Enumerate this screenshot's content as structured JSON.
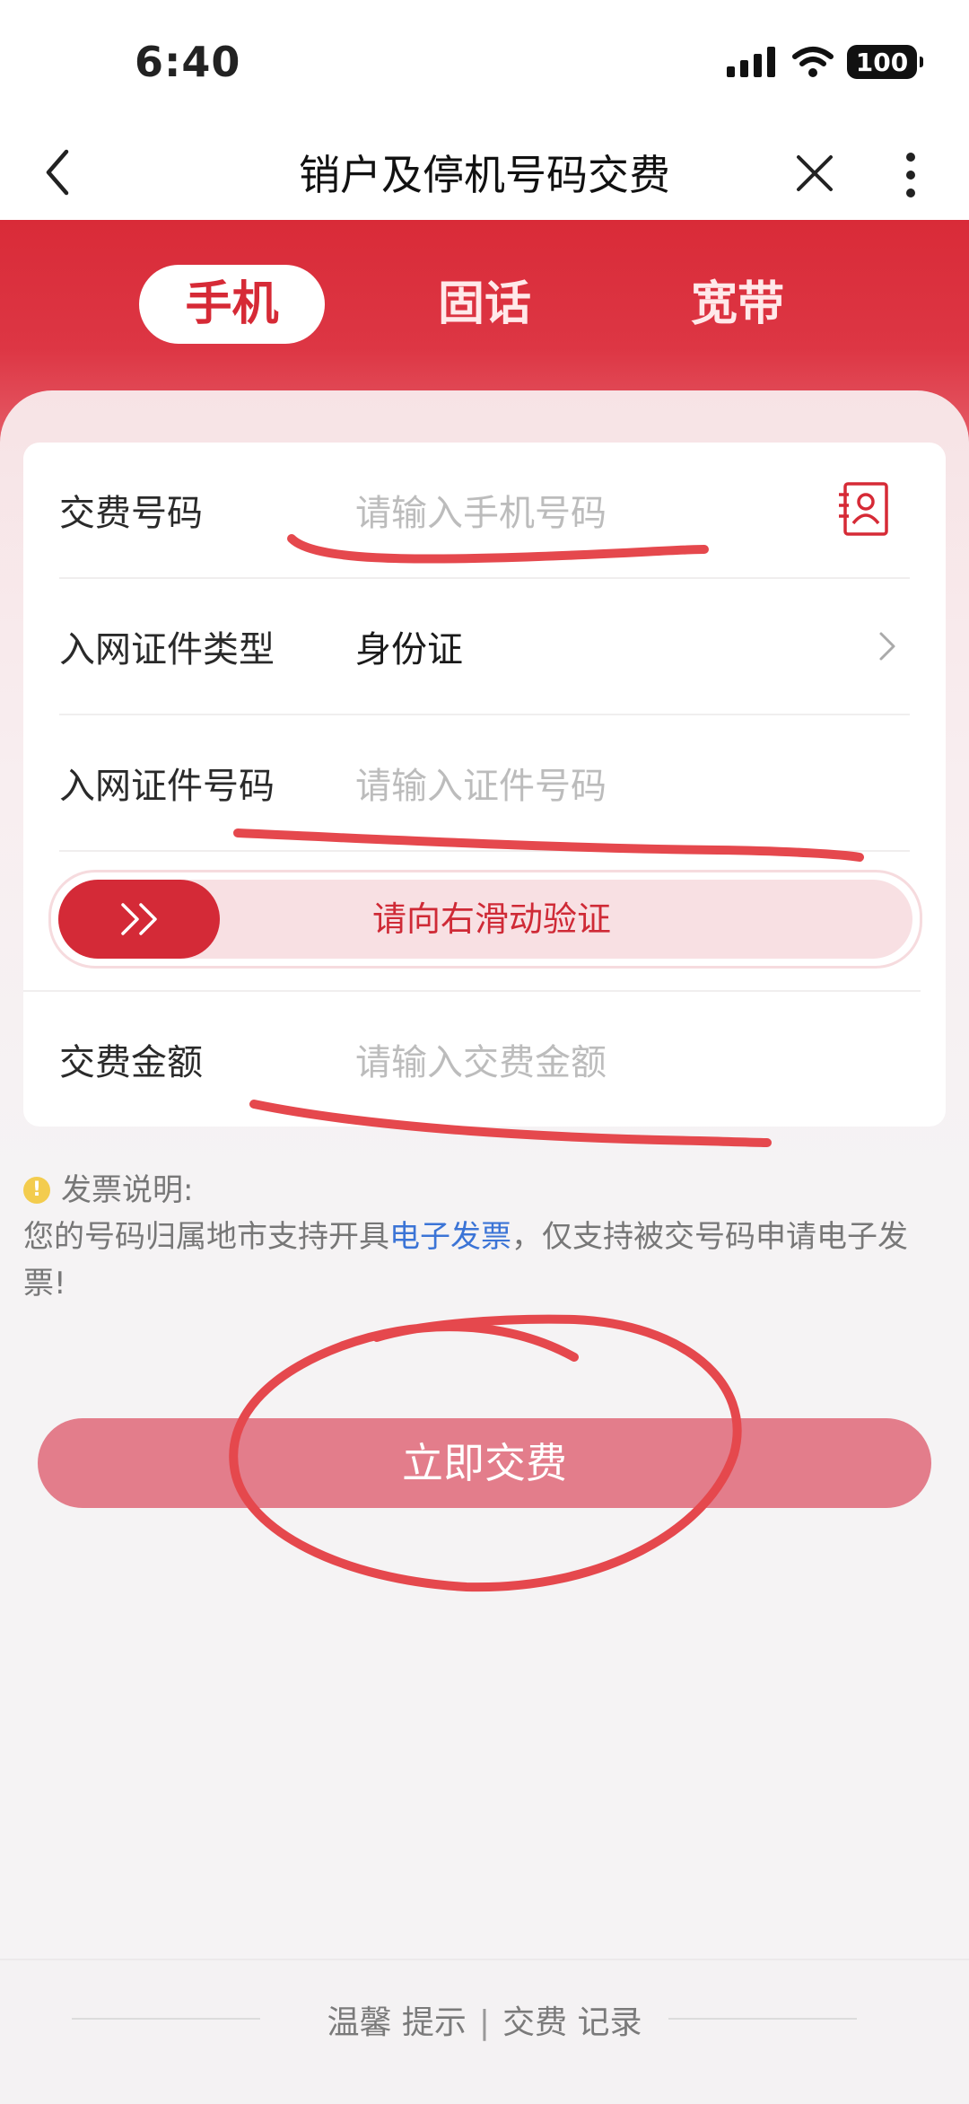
{
  "status_bar": {
    "time": "6:40",
    "battery": "100"
  },
  "nav": {
    "title": "销户及停机号码交费"
  },
  "tabs": [
    {
      "label": "手机",
      "active": true
    },
    {
      "label": "固话",
      "active": false
    },
    {
      "label": "宽带",
      "active": false
    }
  ],
  "form": {
    "phone": {
      "label": "交费号码",
      "placeholder": "请输入手机号码"
    },
    "id_type": {
      "label": "入网证件类型",
      "value": "身份证"
    },
    "id_number": {
      "label": "入网证件号码",
      "placeholder": "请输入证件号码"
    },
    "slider": {
      "text": "请向右滑动验证"
    },
    "amount": {
      "label": "交费金额",
      "placeholder": "请输入交费金额"
    }
  },
  "notice": {
    "title": "发票说明:",
    "text_before": "您的号码归属地市支持开具",
    "link": "电子发票",
    "text_after": "，仅支持被交号码申请电子发票!"
  },
  "pay_button": {
    "label": "立即交费"
  },
  "footer": {
    "tip": "温馨 提示",
    "divider": "|",
    "records": "交费 记录"
  },
  "colors": {
    "primary": "#d62a36",
    "annotation": "#e5484d",
    "link": "#3b74d6"
  }
}
